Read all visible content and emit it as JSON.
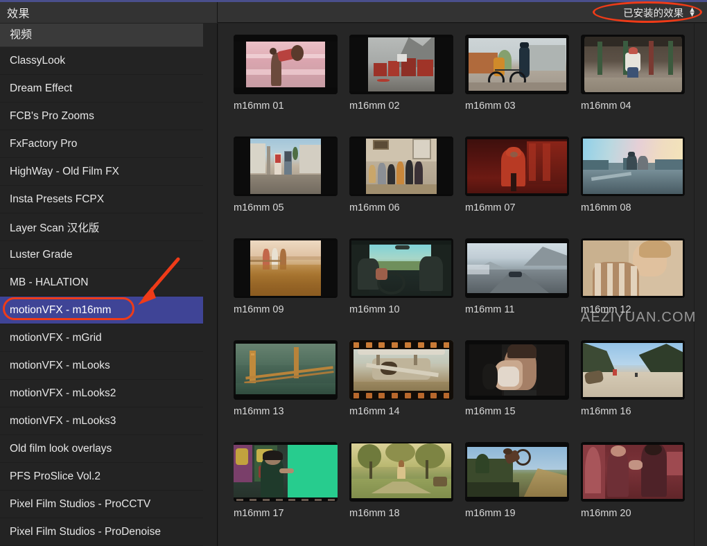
{
  "window": {
    "accent_color": "#4a4f8c",
    "background": "#212121"
  },
  "header": {
    "title": "效果",
    "popup": {
      "label": "已安装的效果",
      "icon": "chevron-up-down-icon",
      "highlight_color": "#ef3b18"
    }
  },
  "sidebar": {
    "section_label": "视频",
    "selected_index": 9,
    "selection_color": "#3f4496",
    "items": [
      {
        "label": "ClassyLook"
      },
      {
        "label": "Dream Effect"
      },
      {
        "label": "FCB's Pro Zooms"
      },
      {
        "label": "FxFactory Pro"
      },
      {
        "label": "HighWay - Old Film FX"
      },
      {
        "label": "Insta Presets FCPX"
      },
      {
        "label": "Layer Scan 汉化版"
      },
      {
        "label": "Luster Grade"
      },
      {
        "label": "MB - HALATION"
      },
      {
        "label": "motionVFX - m16mm"
      },
      {
        "label": "motionVFX - mGrid"
      },
      {
        "label": "motionVFX - mLooks"
      },
      {
        "label": "motionVFX - mLooks2"
      },
      {
        "label": "motionVFX - mLooks3"
      },
      {
        "label": "Old film look overlays"
      },
      {
        "label": "PFS ProSlice Vol.2"
      },
      {
        "label": "Pixel Film Studios - ProCCTV"
      },
      {
        "label": "Pixel Film Studios - ProDenoise"
      }
    ]
  },
  "effects_grid": {
    "items": [
      {
        "label": "m16mm 01",
        "scene": "couple-on-pink-beach"
      },
      {
        "label": "m16mm 02",
        "scene": "nordic-red-village"
      },
      {
        "label": "m16mm 03",
        "scene": "street-bicycle"
      },
      {
        "label": "m16mm 04",
        "scene": "woman-under-overpass"
      },
      {
        "label": "m16mm 05",
        "scene": "couple-walking-street"
      },
      {
        "label": "m16mm 06",
        "scene": "friends-in-room"
      },
      {
        "label": "m16mm 07",
        "scene": "red-hoodie-indoor"
      },
      {
        "label": "m16mm 08",
        "scene": "rooftop-city-sunset"
      },
      {
        "label": "m16mm 09",
        "scene": "field-golden-grass"
      },
      {
        "label": "m16mm 10",
        "scene": "car-interior-road"
      },
      {
        "label": "m16mm 11",
        "scene": "snowy-mountain-road"
      },
      {
        "label": "m16mm 12",
        "scene": "woman-striped-shirt"
      },
      {
        "label": "m16mm 13",
        "scene": "golden-gate-bridge"
      },
      {
        "label": "m16mm 14",
        "scene": "biplane-film-sprockets"
      },
      {
        "label": "m16mm 15",
        "scene": "woman-dark-portrait"
      },
      {
        "label": "m16mm 16",
        "scene": "beach-cliff-blue-sky"
      },
      {
        "label": "m16mm 17",
        "scene": "green-screen-arcade"
      },
      {
        "label": "m16mm 18",
        "scene": "woman-autumn-park"
      },
      {
        "label": "m16mm 19",
        "scene": "bmx-dirt-jump"
      },
      {
        "label": "m16mm 20",
        "scene": "red-interior-couple"
      }
    ]
  },
  "watermark": {
    "text": "AEZIYUAN.COM"
  }
}
